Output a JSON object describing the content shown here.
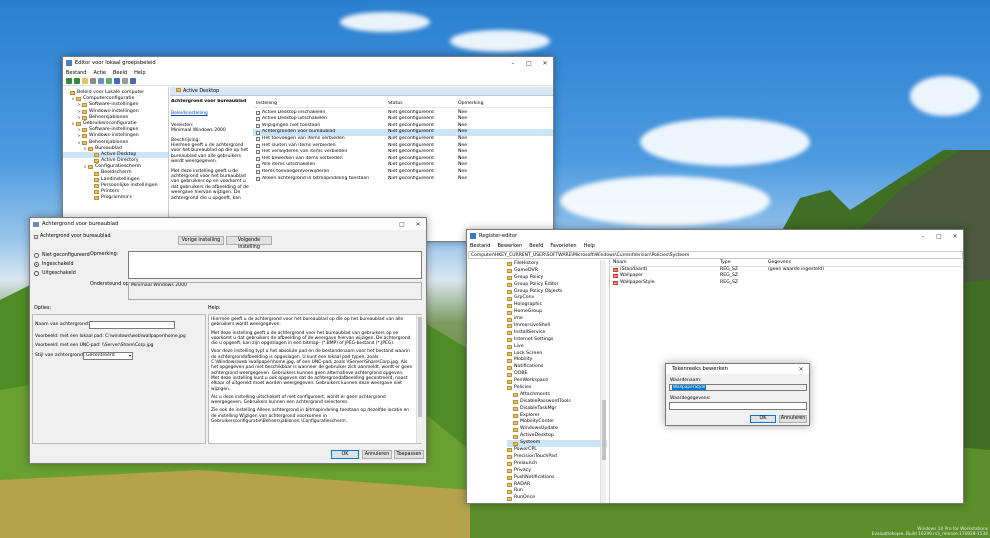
{
  "gpedit": {
    "title": "Editor voor lokaal groepsbeleid",
    "menu": [
      "Bestand",
      "Actie",
      "Beeld",
      "Help"
    ],
    "tree": [
      {
        "label": "Beleid voor Lokale computer",
        "level": 0,
        "exp": ""
      },
      {
        "label": "Computerconfiguratie",
        "level": 1,
        "exp": "v"
      },
      {
        "label": "Software-instellingen",
        "level": 2,
        "exp": ">"
      },
      {
        "label": "Windows-instellingen",
        "level": 2,
        "exp": ">"
      },
      {
        "label": "Beheersjablonen",
        "level": 2,
        "exp": ">"
      },
      {
        "label": "Gebruikersconfiguratie",
        "level": 1,
        "exp": "v"
      },
      {
        "label": "Software-instellingen",
        "level": 2,
        "exp": ">"
      },
      {
        "label": "Windows-instellingen",
        "level": 2,
        "exp": ">"
      },
      {
        "label": "Beheersjablonen",
        "level": 2,
        "exp": "v"
      },
      {
        "label": "Bureaublad",
        "level": 3,
        "exp": "v"
      },
      {
        "label": "Active Desktop",
        "level": 4,
        "exp": "",
        "selected": true
      },
      {
        "label": "Active Directory",
        "level": 4,
        "exp": ""
      },
      {
        "label": "Configuratiescherm",
        "level": 3,
        "exp": "v"
      },
      {
        "label": "Beeldscherm",
        "level": 4,
        "exp": ""
      },
      {
        "label": "Landinstellingen",
        "level": 4,
        "exp": ""
      },
      {
        "label": "Persoonlijke instellingen",
        "level": 4,
        "exp": ""
      },
      {
        "label": "Printers",
        "level": 4,
        "exp": ""
      },
      {
        "label": "Programma's",
        "level": 4,
        "exp": ""
      }
    ],
    "section_header": "Active Desktop",
    "desc_title": "Achtergrond voor bureaublad",
    "desc_link": "Beleidsinstelling",
    "req_label": "Vereisten:",
    "req_value": "Minimaal Windows 2000",
    "desc_label": "Beschrijving:",
    "desc_text": "Hiermee geeft u de achtergrond voor het bureaublad op die op het bureaublad van alle gebruikers wordt weergegeven.",
    "desc_text2": "Met deze instelling geeft u de achtergrond voor het bureaublad van gebruikers op en voorkomt u dat gebruikers de afbeelding of de weergave hiervan wijzigen. De achtergrond die u opgeeft, kan",
    "columns": [
      "Instelling",
      "Status",
      "Opmerking"
    ],
    "rows": [
      {
        "name": "Active Desktop inschakelen",
        "status": "Niet geconfigureerd",
        "note": "Nee"
      },
      {
        "name": "Active Desktop uitschakelen",
        "status": "Niet geconfigureerd",
        "note": "Nee"
      },
      {
        "name": "Wijzigingen niet toestaan",
        "status": "Niet geconfigureerd",
        "note": "Nee"
      },
      {
        "name": "Achtergronden voor bureaublad",
        "status": "Niet geconfigureerd",
        "note": "Nee",
        "selected": true
      },
      {
        "name": "Het toevoegen van items verbieden",
        "status": "Niet geconfigureerd",
        "note": "Nee"
      },
      {
        "name": "Het sluiten van items verbieden",
        "status": "Niet geconfigureerd",
        "note": "Nee"
      },
      {
        "name": "Het verwijderen van items verbieden",
        "status": "Niet geconfigureerd",
        "note": "Nee"
      },
      {
        "name": "Het bewerken van items verbieden",
        "status": "Niet geconfigureerd",
        "note": "Nee"
      },
      {
        "name": "Alle items uitschakelen",
        "status": "Niet geconfigureerd",
        "note": "Nee"
      },
      {
        "name": "Items toevoegen/verwijderen",
        "status": "Niet geconfigureerd",
        "note": "Nee"
      },
      {
        "name": "Alleen achtergrond in bitmapindeling toestaan",
        "status": "Niet geconfigureerd",
        "note": "Nee"
      }
    ]
  },
  "policy": {
    "title": "Achtergrond voor bureaublad",
    "subtitle": "Achtergrond voor bureaublad",
    "prev_button": "Vorige instelling",
    "next_button": "Volgende instelling",
    "radio_not_configured": "Niet geconfigureerd",
    "radio_enabled": "Ingeschakeld",
    "radio_disabled": "Uitgeschakeld",
    "comment_label": "Opmerking:",
    "supported_label": "Ondersteund op:",
    "supported_value": "Minimaal Windows 2000",
    "options_label": "Opties:",
    "help_label": "Help:",
    "name_label": "Naam van achtergrond:",
    "example_local": "Voorbeeld: met een lokaal pad:  C:\\windows\\web\\wallpaper\\home.jpg",
    "example_unc": "Voorbeeld: met een UNC-pad:  \\\\Server\\Share\\Corp.jpg",
    "style_label": "Stijl van achtergrond:",
    "style_value": "Gecentreerd",
    "help": [
      "Hiermee geeft u de achtergrond voor het bureaublad op die op het bureaublad van alle gebruikers wordt weergegeven.",
      "Met deze instelling geeft u de achtergrond voor het bureaublad van gebruikers op en voorkomt u dat gebruikers de afbeelding of de weergave hiervan wijzigen. De achtergrond die u opgeeft, kan zijn opgeslagen in een bitmap- (*.BMP) of JPEG-bestand (*.JPEG).",
      "Voor deze instelling typt u het absolute pad en de bestandsnaam voor het bestand waarin de achtergrondafbeelding is opgeslagen. U kunt een lokaal pad typen, zoals C:\\Windows\\web \\wallpaper\\home.jpg, of een UNC-pad, zoals \\\\Server\\Share\\Corp.jpg. Als het opgegeven pad niet beschikbaar is wanneer de gebruiker zich aanmeldt, wordt er geen achtergrond weergegeven. Gebruikers kunnen geen alternatieve achtergrond opgeven. Met deze instelling kunt u ook opgeven dat de achtergrondafbeelding gecentreerd, naast elkaar of uitgerekt moet worden weergegeven. Gebruikers kunnen deze weergave niet wijzigen.",
      "Als u deze instelling uitschakelt of niet configureert, wordt er geen achtergrond weergegeven. Gebruikers kunnen een achtergrond selecteren.",
      "Zie ook de instelling Alleen achtergrond in bitmapindeling toestaan op dezelfde locatie en de instelling Wijzigen van achtergrond voorkomen in Gebruikersconfiguratie\\Beheersjablonen \\Configuratiescherm."
    ],
    "ok_button": "OK",
    "cancel_button": "Annuleren",
    "apply_button": "Toepassen"
  },
  "regedit": {
    "title": "Register-editor",
    "menu": [
      "Bestand",
      "Bewerken",
      "Beeld",
      "Favorieten",
      "Help"
    ],
    "path": "Computer\\HKEY_CURRENT_USER\\SOFTWARE\\Microsoft\\Windows\\CurrentVersion\\Policies\\Systeem",
    "tree": [
      {
        "label": "FileHistory",
        "level": 0
      },
      {
        "label": "GameDVR",
        "level": 0
      },
      {
        "label": "Group Policy",
        "level": 0
      },
      {
        "label": "Group Policy Editor",
        "level": 0
      },
      {
        "label": "Group Policy Objects",
        "level": 0
      },
      {
        "label": "GrpConv",
        "level": 0
      },
      {
        "label": "Holographic",
        "level": 0
      },
      {
        "label": "HomeGroup",
        "level": 0
      },
      {
        "label": "ime",
        "level": 0
      },
      {
        "label": "ImmersiveShell",
        "level": 0
      },
      {
        "label": "InstallService",
        "level": 0
      },
      {
        "label": "Internet Settings",
        "level": 0
      },
      {
        "label": "Live",
        "level": 0
      },
      {
        "label": "Lock Screen",
        "level": 0
      },
      {
        "label": "Mobility",
        "level": 0
      },
      {
        "label": "Notifications",
        "level": 0
      },
      {
        "label": "OOBE",
        "level": 0
      },
      {
        "label": "PenWorkspace",
        "level": 0
      },
      {
        "label": "Policies",
        "level": 0
      },
      {
        "label": "Attachments",
        "level": 1
      },
      {
        "label": "DisablePasswordTools",
        "level": 1
      },
      {
        "label": "DisableTaskMgr",
        "level": 1
      },
      {
        "label": "Explorer",
        "level": 1
      },
      {
        "label": "MobilityCenter",
        "level": 1
      },
      {
        "label": "WindowsUpdate",
        "level": 1
      },
      {
        "label": "ActiveDesktop",
        "level": 1
      },
      {
        "label": "Systeem",
        "level": 1,
        "selected": true
      },
      {
        "label": "PowerCPL",
        "level": 0
      },
      {
        "label": "PrecisionTouchPad",
        "level": 0
      },
      {
        "label": "Prelaunch",
        "level": 0
      },
      {
        "label": "Privacy",
        "level": 0
      },
      {
        "label": "PushNotifications",
        "level": 0
      },
      {
        "label": "RADAR",
        "level": 0
      },
      {
        "label": "Run",
        "level": 0
      },
      {
        "label": "RunOnce",
        "level": 0
      }
    ],
    "columns": [
      "Naam",
      "Type",
      "Gegevens"
    ],
    "values": [
      {
        "name": "(Standaard)",
        "type": "REG_SZ",
        "data": "(geen waarde ingesteld)"
      },
      {
        "name": "Wallpaper",
        "type": "REG_SZ",
        "data": ""
      },
      {
        "name": "WallpaperStyle",
        "type": "REG_SZ",
        "data": ""
      }
    ]
  },
  "editstring": {
    "title": "Tekenreeks bewerken",
    "name_label": "Waardenaam:",
    "name_value": "WallpaperStyle",
    "data_label": "Waardegegevens:",
    "data_value": "",
    "ok_button": "OK",
    "cancel_button": "Annuleren"
  },
  "watermark": {
    "line1": "Windows 10 Pro for Workstations",
    "line2": "Evaluatiekopie. Build 16299.rs3_release.170928-1534"
  }
}
